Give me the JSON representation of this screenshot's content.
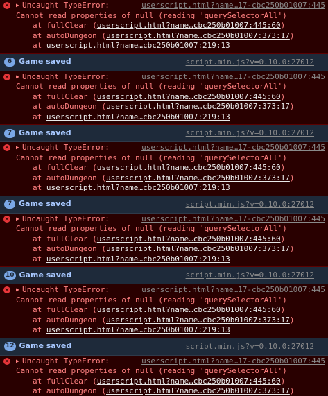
{
  "console": {
    "entries": [
      {
        "type": "error",
        "heading": "Uncaught TypeError:",
        "source": "userscript.html?name…17-cbc250b01007:445",
        "message": "Cannot read properties of null (reading 'querySelectorAll')",
        "frames": [
          {
            "prefix": "at fullClear (",
            "link": "userscript.html?name…cbc250b01007:445:60",
            "suffix": ")"
          },
          {
            "prefix": "at autoDungeon (",
            "link": "userscript.html?name…cbc250b01007:373:17",
            "suffix": ")"
          },
          {
            "prefix": "at ",
            "link": "userscript.html?name…cbc250b01007:219:13",
            "suffix": ""
          }
        ]
      },
      {
        "type": "log",
        "count": "6",
        "message": "Game saved",
        "source": "script.min.js?v=0.10.0:27012"
      },
      {
        "type": "error",
        "heading": "Uncaught TypeError:",
        "source": "userscript.html?name…17-cbc250b01007:445",
        "message": "Cannot read properties of null (reading 'querySelectorAll')",
        "frames": [
          {
            "prefix": "at fullClear (",
            "link": "userscript.html?name…cbc250b01007:445:60",
            "suffix": ")"
          },
          {
            "prefix": "at autoDungeon (",
            "link": "userscript.html?name…cbc250b01007:373:17",
            "suffix": ")"
          },
          {
            "prefix": "at ",
            "link": "userscript.html?name…cbc250b01007:219:13",
            "suffix": ""
          }
        ]
      },
      {
        "type": "log",
        "count": "7",
        "message": "Game saved",
        "source": "script.min.js?v=0.10.0:27012"
      },
      {
        "type": "error",
        "heading": "Uncaught TypeError:",
        "source": "userscript.html?name…17-cbc250b01007:445",
        "message": "Cannot read properties of null (reading 'querySelectorAll')",
        "frames": [
          {
            "prefix": "at fullClear (",
            "link": "userscript.html?name…cbc250b01007:445:60",
            "suffix": ")"
          },
          {
            "prefix": "at autoDungeon (",
            "link": "userscript.html?name…cbc250b01007:373:17",
            "suffix": ")"
          },
          {
            "prefix": "at ",
            "link": "userscript.html?name…cbc250b01007:219:13",
            "suffix": ""
          }
        ]
      },
      {
        "type": "log",
        "count": "7",
        "message": "Game saved",
        "source": "script.min.js?v=0.10.0:27012"
      },
      {
        "type": "error",
        "heading": "Uncaught TypeError:",
        "source": "userscript.html?name…17-cbc250b01007:445",
        "message": "Cannot read properties of null (reading 'querySelectorAll')",
        "frames": [
          {
            "prefix": "at fullClear (",
            "link": "userscript.html?name…cbc250b01007:445:60",
            "suffix": ")"
          },
          {
            "prefix": "at autoDungeon (",
            "link": "userscript.html?name…cbc250b01007:373:17",
            "suffix": ")"
          },
          {
            "prefix": "at ",
            "link": "userscript.html?name…cbc250b01007:219:13",
            "suffix": ""
          }
        ]
      },
      {
        "type": "log",
        "count": "10",
        "message": "Game saved",
        "source": "script.min.js?v=0.10.0:27012"
      },
      {
        "type": "error",
        "heading": "Uncaught TypeError:",
        "source": "userscript.html?name…17-cbc250b01007:445",
        "message": "Cannot read properties of null (reading 'querySelectorAll')",
        "frames": [
          {
            "prefix": "at fullClear (",
            "link": "userscript.html?name…cbc250b01007:445:60",
            "suffix": ")"
          },
          {
            "prefix": "at autoDungeon (",
            "link": "userscript.html?name…cbc250b01007:373:17",
            "suffix": ")"
          },
          {
            "prefix": "at ",
            "link": "userscript.html?name…cbc250b01007:219:13",
            "suffix": ""
          }
        ]
      },
      {
        "type": "log",
        "count": "12",
        "message": "Game saved",
        "source": "script.min.js?v=0.10.0:27012"
      },
      {
        "type": "error",
        "heading": "Uncaught TypeError:",
        "source": "userscript.html?name…17-cbc250b01007:445",
        "message": "Cannot read properties of null (reading 'querySelectorAll')",
        "frames": [
          {
            "prefix": "at fullClear (",
            "link": "userscript.html?name…cbc250b01007:445:60",
            "suffix": ")"
          },
          {
            "prefix": "at autoDungeon (",
            "link": "userscript.html?name…cbc250b01007:373:17",
            "suffix": ")"
          },
          {
            "prefix": "at ",
            "link": "userscript.html?name…cbc250b01007:219:13",
            "suffix": ""
          }
        ]
      }
    ]
  },
  "icons": {
    "error": "error-circle-icon",
    "expand": "expand-triangle-icon",
    "error_glyph": "×",
    "expand_glyph": "▶"
  },
  "colors": {
    "error_bg": "#290000",
    "error_text": "#ff8080",
    "log_bg": "#1e2a3a",
    "log_text": "#a8c8ff",
    "badge": "#7aa7e6"
  }
}
